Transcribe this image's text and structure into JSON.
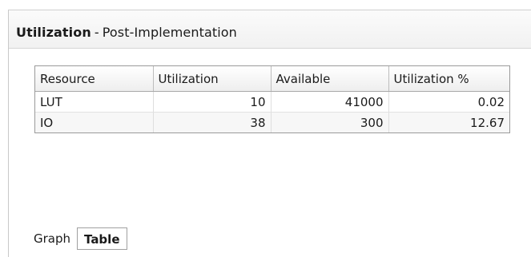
{
  "panel": {
    "title_bold": "Utilization",
    "title_sep": "-",
    "title_rest": "Post-Implementation"
  },
  "table": {
    "headers": [
      "Resource",
      "Utilization",
      "Available",
      "Utilization %"
    ],
    "rows": [
      {
        "resource": "LUT",
        "utilization": "10",
        "available": "41000",
        "percent": "0.02"
      },
      {
        "resource": "IO",
        "utilization": "38",
        "available": "300",
        "percent": "12.67"
      }
    ]
  },
  "tabs": [
    {
      "label": "Graph",
      "active": false
    },
    {
      "label": "Table",
      "active": true
    }
  ]
}
